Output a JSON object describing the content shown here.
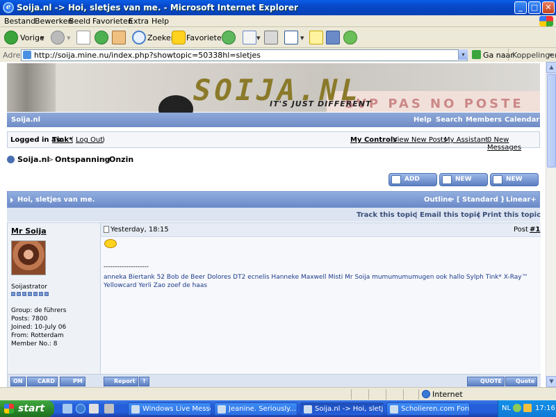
{
  "window": {
    "title": "Soija.nl -> Hoi, sletjes van me. - Microsoft Internet Explorer",
    "ie_glyph": "e",
    "minimize": "_",
    "maximize": "□",
    "close": "✕"
  },
  "menu": [
    "Bestand",
    "Bewerken",
    "Beeld",
    "Favorieten",
    "Extra",
    "Help"
  ],
  "toolbar": {
    "back": "Vorige",
    "search": "Zoeken",
    "favorites": "Favorieten",
    "dropdown": "▾"
  },
  "address": {
    "label": "Adres",
    "url": "http://soija.mine.nu/index.php?showtopic=50338hl=sletjes",
    "go": "Ga naar",
    "links": "Koppelingen",
    "more": "»"
  },
  "banner": {
    "logo": "SOIJA.NL",
    "tagline": "IT'S JUST DIFFERENT",
    "sign": "SVP PAS   NO POSTE"
  },
  "nav": {
    "site": "Soija.nl",
    "items": [
      "Help",
      "Search",
      "Members",
      "Calendar"
    ]
  },
  "userstrip": {
    "logged_label": "Logged in as:",
    "user": "Tink*",
    "paren_open": "(",
    "logout": "Log Out",
    "paren_close": ")",
    "links": [
      "My Controls",
      "View New Posts",
      "My Assistant",
      "0 New Messages"
    ],
    "sep": "·"
  },
  "breadcrumb": [
    "Soija.nl",
    "Ontspanning",
    "Onzin"
  ],
  "breadcrumb_sep": ">",
  "actions": [
    "Add Reply",
    "New Topic",
    "New Poll"
  ],
  "topic": {
    "title": "Hoi, sletjes van me.",
    "outline": "Outline",
    "standard": "[ Standard ]",
    "linear": "Linear+",
    "sep": "·",
    "bar": [
      "Track this topic",
      "Email this topic",
      "Print this topic"
    ],
    "bar_sep": "|"
  },
  "post": {
    "author": "Mr Soija",
    "date": "Yesterday, 18:15",
    "post_label": "Post",
    "post_num": "#1",
    "rank": "Soijastrator",
    "pips": 7,
    "group": "Group: de führers",
    "posts": "Posts: 7800",
    "joined": "Joined: 10-July 06",
    "from": "From: Rotterdam",
    "member_no": "Member No.: 8",
    "divider": "--------------------",
    "signature_line1": "anneka Biertank 52 Bob de Beer Dolores DT2 ecnelis Hanneke Maxwell Misti Mr Soija mumumumumugen ook hallo Sylph Tink* X-Ray™",
    "signature_line2": "Yellowcard Yerli Zao zoef de haas",
    "foot": {
      "on": "ON",
      "card": "CARD",
      "pm": "PM",
      "report": "Report",
      "up": "↑",
      "quote": "Quote",
      "quote2": "Quote"
    }
  },
  "statusbar": {
    "zone": "Internet"
  },
  "taskbar": {
    "start": "start",
    "tasks": [
      "Windows Live Messen...",
      "Jeanine.    Seriously...",
      "Soija.nl -> Hoi, sletje...",
      "Scholieren.com Foru..."
    ],
    "active_task": 2,
    "lang": "NL",
    "time": "17:16"
  },
  "colors": {
    "nav_blue": "#6E8CC6",
    "xp_blue": "#245EDB",
    "start_green": "#2E8B2E"
  }
}
